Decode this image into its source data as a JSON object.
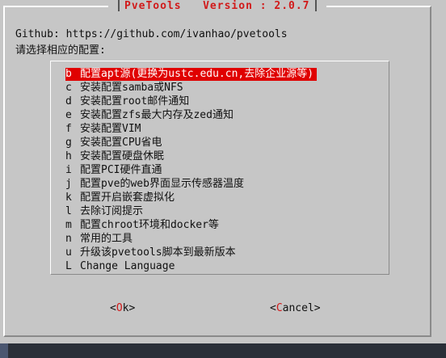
{
  "dialog": {
    "title": "PveTools",
    "version": "Version : 2.0.7",
    "github_line": "Github: https://github.com/ivanhao/pvetools",
    "prompt": "请选择相应的配置:"
  },
  "menu": {
    "items": [
      {
        "key": "b",
        "label": "配置apt源(更换为ustc.edu.cn,去除企业源等)",
        "selected": true
      },
      {
        "key": "c",
        "label": "安装配置samba或NFS"
      },
      {
        "key": "d",
        "label": "安装配置root邮件通知"
      },
      {
        "key": "e",
        "label": "安装配置zfs最大内存及zed通知"
      },
      {
        "key": "f",
        "label": "安装配置VIM"
      },
      {
        "key": "g",
        "label": "安装配置CPU省电"
      },
      {
        "key": "h",
        "label": "安装配置硬盘休眠"
      },
      {
        "key": "i",
        "label": "配置PCI硬件直通"
      },
      {
        "key": "j",
        "label": "配置pve的web界面显示传感器温度"
      },
      {
        "key": "k",
        "label": "配置开启嵌套虚拟化"
      },
      {
        "key": "l",
        "label": "去除订阅提示"
      },
      {
        "key": "m",
        "label": "配置chroot环境和docker等"
      },
      {
        "key": "n",
        "label": "常用的工具"
      },
      {
        "key": "u",
        "label": "升级该pvetools脚本到最新版本"
      },
      {
        "key": "L",
        "label": "Change Language"
      }
    ]
  },
  "buttons": {
    "ok": "<Ok>",
    "cancel": "<Cancel>"
  },
  "colors": {
    "dialog_bg": "#c6c6c6",
    "screen_bg": "#4a5670",
    "selection_bg": "#e00000",
    "title_fg": "#d11a1a"
  }
}
